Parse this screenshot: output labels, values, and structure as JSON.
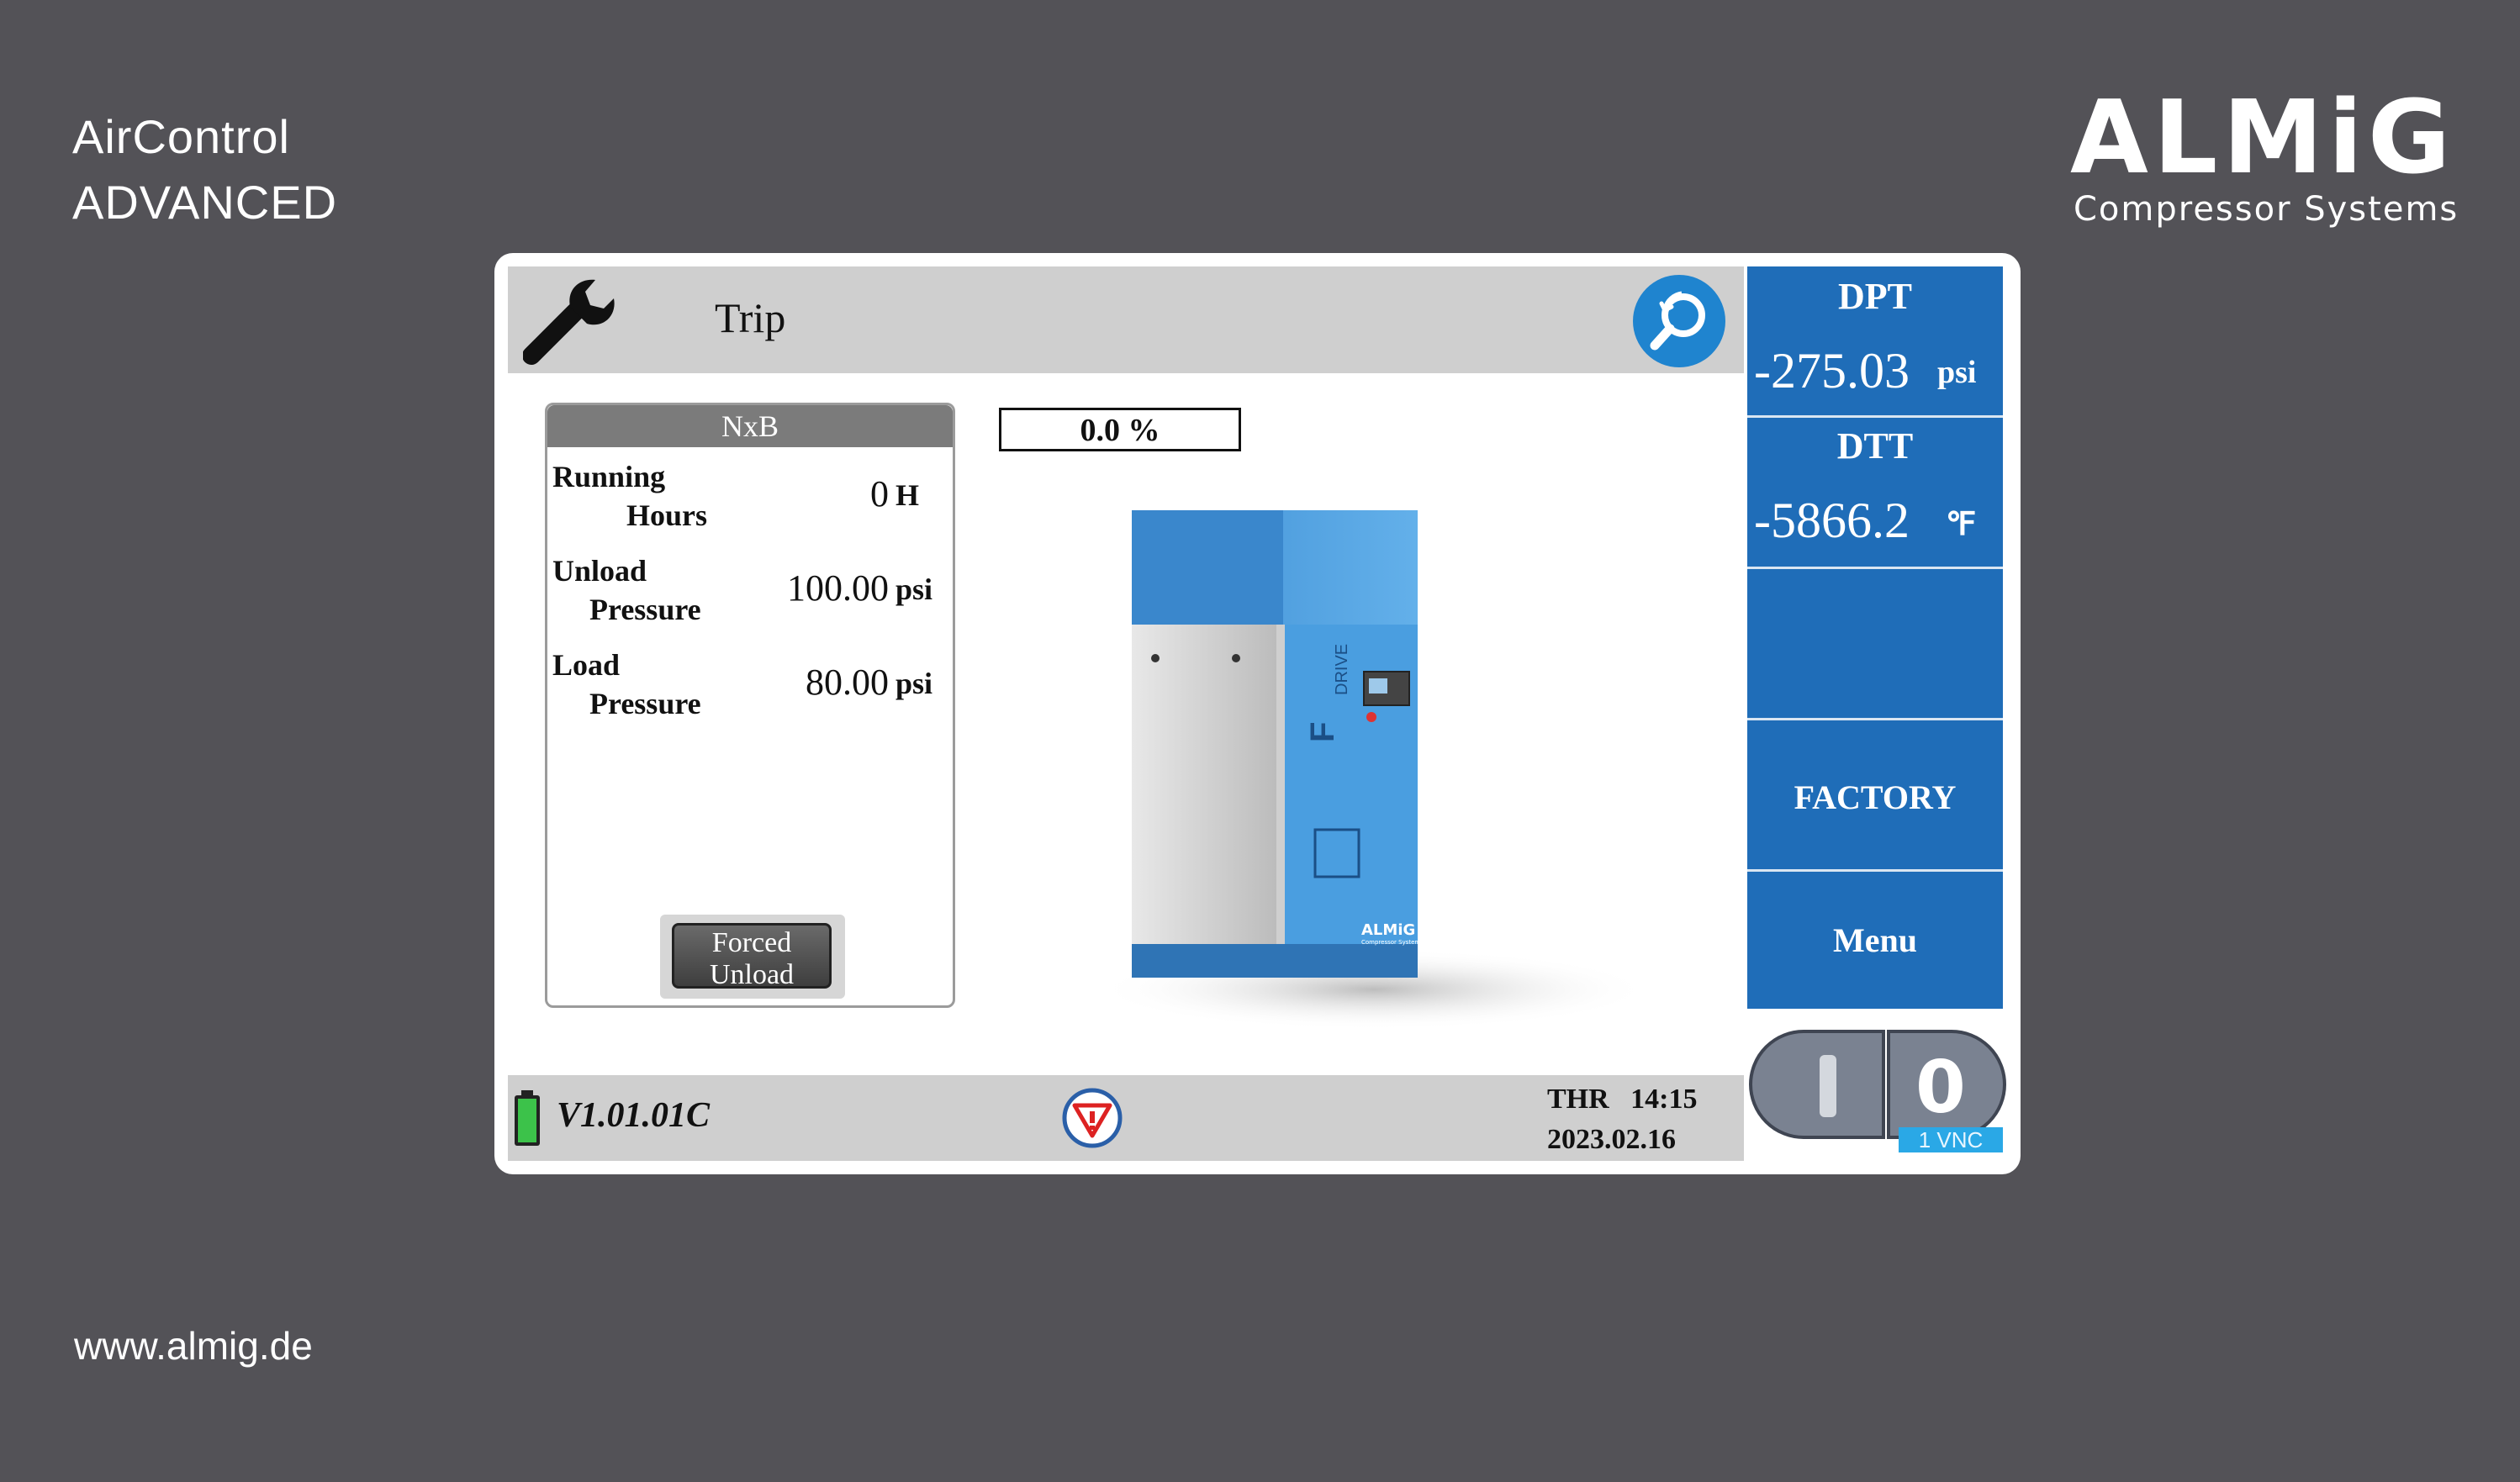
{
  "branding": {
    "title_line1": "AirControl",
    "title_line2": "ADVANCED",
    "url": "www.almig.de",
    "logo_word": "ALMiG",
    "logo_sub": "Compressor Systems"
  },
  "header": {
    "title": "Trip",
    "icon": "wrench-icon",
    "search_icon": "search-icon"
  },
  "right_panel": {
    "dpt_label": "DPT",
    "dpt_value": "-275.03",
    "dpt_unit": "psi",
    "dtt_label": "DTT",
    "dtt_value": "-5866.2",
    "dtt_unit": "℉",
    "factory_label": "FACTORY",
    "menu_label": "Menu"
  },
  "info": {
    "title": "NxB",
    "rows": [
      {
        "label1": "Running",
        "label2": "Hours",
        "value": "0",
        "unit": "H"
      },
      {
        "label1": "Unload",
        "label2": "Pressure",
        "value": "100.00",
        "unit": "psi"
      },
      {
        "label1": "Load",
        "label2": "Pressure",
        "value": "80.00",
        "unit": "psi"
      }
    ],
    "forced_line1": "Forced",
    "forced_line2": "Unload"
  },
  "percent": "0.0 %",
  "machine": {
    "brand": "ALMiG",
    "brand_sub": "Compressor Systems",
    "drive_label": "DRIVE",
    "drive_letter": "F"
  },
  "status": {
    "version": "V1.01.01C",
    "day_time": "THR   14:15",
    "date": "2023.02.16"
  },
  "switch": {
    "on_label": "I",
    "off_label": "0",
    "vnc_label": "1 VNC"
  },
  "colors": {
    "background": "#535257",
    "panel_blue": "#1f6db8",
    "search_blue": "#1f84cf",
    "machine_blue": "#4a9ee0"
  }
}
